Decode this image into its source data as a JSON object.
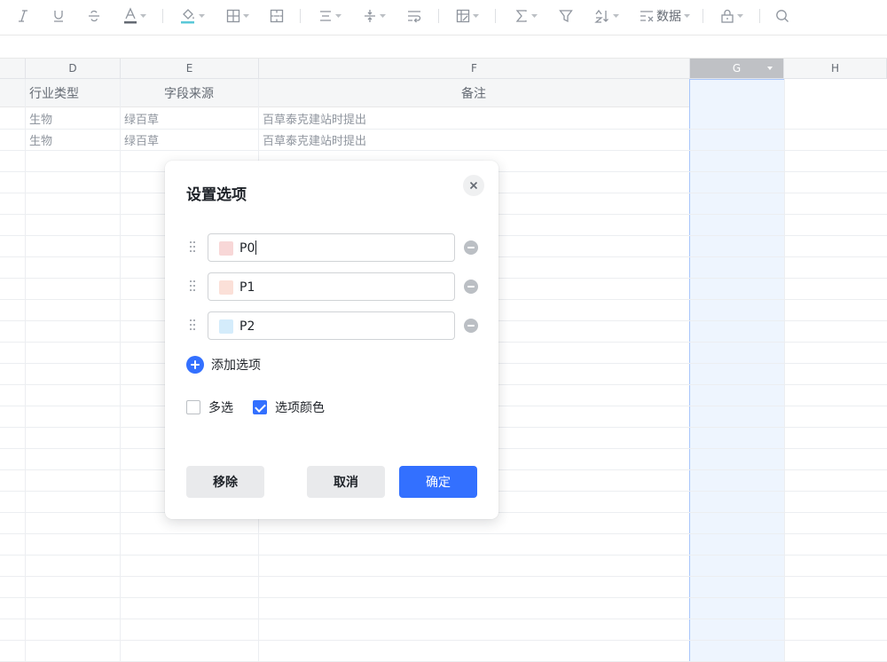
{
  "toolbar": {
    "items": [
      {
        "name": "italic-icon"
      },
      {
        "name": "underline-icon"
      },
      {
        "name": "strikethrough-icon"
      },
      {
        "name": "font-color-icon"
      },
      {
        "name": "fill-color-icon"
      },
      {
        "name": "borders-icon"
      },
      {
        "name": "merge-cells-icon"
      },
      {
        "name": "horizontal-align-icon"
      },
      {
        "name": "vertical-align-icon"
      },
      {
        "name": "wrap-text-icon"
      },
      {
        "name": "conditional-format-icon"
      },
      {
        "name": "sum-icon"
      },
      {
        "name": "filter-icon"
      },
      {
        "name": "sort-icon"
      },
      {
        "name": "data-icon"
      },
      {
        "name": "lock-icon"
      },
      {
        "name": "search-icon"
      }
    ],
    "data_label": "数据"
  },
  "sheet": {
    "columns": [
      "D",
      "E",
      "F",
      "G",
      "H"
    ],
    "selected_column": "G",
    "headers": [
      "行业类型",
      "字段来源",
      "备注"
    ],
    "rows": [
      [
        "生物",
        "绿百草",
        "百草泰克建站时提出"
      ],
      [
        "生物",
        "绿百草",
        "百草泰克建站时提出"
      ]
    ]
  },
  "dialog": {
    "title": "设置选项",
    "options": [
      {
        "label": "P0",
        "color": "#f8d7d7"
      },
      {
        "label": "P1",
        "color": "#fbe0d8"
      },
      {
        "label": "P2",
        "color": "#d4ecfb"
      }
    ],
    "add_option": "添加选项",
    "multi_select": {
      "label": "多选",
      "checked": false
    },
    "option_color": {
      "label": "选项颜色",
      "checked": true
    },
    "remove_button": "移除",
    "cancel_button": "取消",
    "confirm_button": "确定"
  },
  "colors": {
    "accent": "#3370ff",
    "selection_fill": "#eef5fe",
    "selection_border": "#a8c6fa"
  }
}
